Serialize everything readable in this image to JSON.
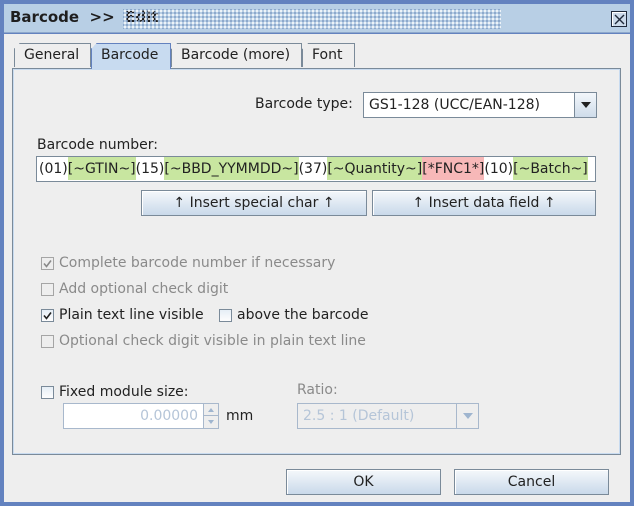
{
  "window": {
    "title": "Barcode  >>  Edit",
    "close_icon": "close-icon"
  },
  "tabs": [
    {
      "label": "General",
      "active": false
    },
    {
      "label": "Barcode",
      "active": true
    },
    {
      "label": "Barcode (more)",
      "active": false
    },
    {
      "label": "Font",
      "active": false
    }
  ],
  "barcode_type": {
    "label": "Barcode type:",
    "value": "GS1-128 (UCC/EAN-128)"
  },
  "barcode_number": {
    "label": "Barcode number:",
    "segments": [
      {
        "text": "(01)",
        "kind": "plain"
      },
      {
        "text": "[~GTIN~]",
        "kind": "field"
      },
      {
        "text": "(15)",
        "kind": "plain"
      },
      {
        "text": "[~BBD_YYMMDD~]",
        "kind": "field"
      },
      {
        "text": "(37)",
        "kind": "plain"
      },
      {
        "text": "[~Quantity~]",
        "kind": "field"
      },
      {
        "text": "[*FNC1*]",
        "kind": "special"
      },
      {
        "text": "(10)",
        "kind": "plain"
      },
      {
        "text": "[~Batch~]",
        "kind": "field"
      }
    ],
    "colors": {
      "field": "#c8e6a0",
      "special": "#f7b8b8"
    }
  },
  "buttons": {
    "insert_special": "↑ Insert special char ↑",
    "insert_field": "↑ Insert data field ↑",
    "ok": "OK",
    "cancel": "Cancel"
  },
  "options": {
    "complete_number": {
      "label": "Complete barcode number if necessary",
      "checked": true,
      "enabled": false
    },
    "add_check_digit": {
      "label": "Add optional check digit",
      "checked": false,
      "enabled": false
    },
    "plain_text_visible": {
      "label": "Plain text line visible",
      "checked": true,
      "enabled": true
    },
    "above_barcode": {
      "label": "above the barcode",
      "checked": false,
      "enabled": true
    },
    "check_digit_visible": {
      "label": "Optional check digit visible in plain text line",
      "checked": false,
      "enabled": false
    }
  },
  "module_size": {
    "label": "Fixed module size:",
    "checked": false,
    "value": "0.00000",
    "unit": "mm"
  },
  "ratio": {
    "label": "Ratio:",
    "value": "2.5 : 1  (Default)"
  },
  "colors": {
    "window_border": "#6382bf",
    "titlebar": "#b8cfe5",
    "active_tab": "#c8dbf0",
    "background": "#eeeeee"
  }
}
